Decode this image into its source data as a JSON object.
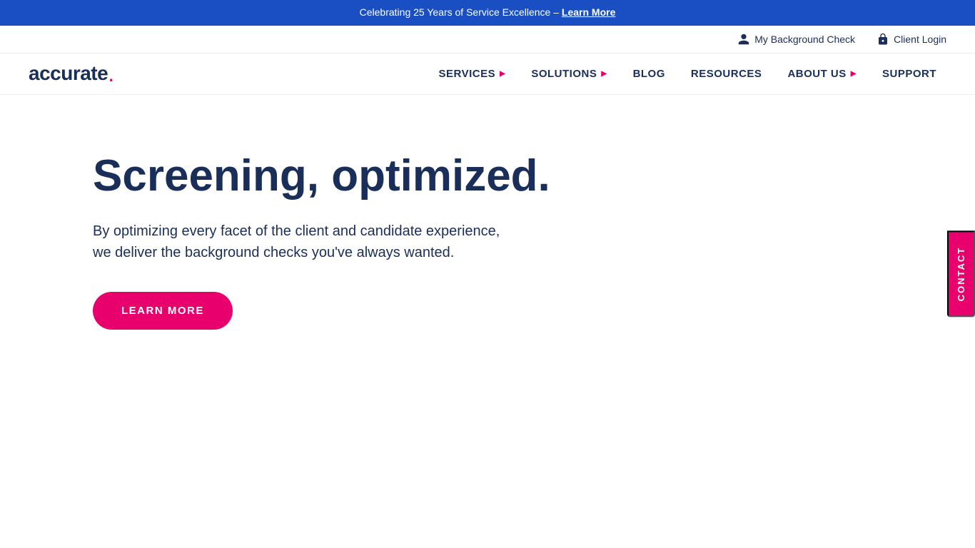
{
  "announcement": {
    "text": "Celebrating 25 Years of Service Excellence – ",
    "link_label": "Learn More"
  },
  "utility_nav": {
    "items": [
      {
        "label": "My Background Check",
        "icon": "person-icon",
        "id": "my-background-check"
      },
      {
        "label": "Client Login",
        "icon": "lock-icon",
        "id": "client-login"
      }
    ]
  },
  "logo": {
    "text": "accurate",
    "dot": "."
  },
  "main_nav": {
    "items": [
      {
        "label": "SERVICES",
        "has_dropdown": true,
        "id": "nav-services"
      },
      {
        "label": "SOLUTIONS",
        "has_dropdown": true,
        "id": "nav-solutions"
      },
      {
        "label": "BLOG",
        "has_dropdown": false,
        "id": "nav-blog"
      },
      {
        "label": "RESOURCES",
        "has_dropdown": false,
        "id": "nav-resources"
      },
      {
        "label": "ABOUT US",
        "has_dropdown": true,
        "id": "nav-about-us"
      },
      {
        "label": "SUPPORT",
        "has_dropdown": false,
        "id": "nav-support"
      }
    ]
  },
  "hero": {
    "title": "Screening, optimized.",
    "subtitle_line1": "By optimizing every facet of the client and candidate experience,",
    "subtitle_line2": "we deliver the background checks you've always wanted.",
    "cta_label": "LEARN MORE"
  },
  "contact_sidebar": {
    "label": "CONTACT"
  },
  "colors": {
    "brand_blue": "#1a2e5a",
    "brand_pink": "#e8006d",
    "banner_blue": "#1a4fc4"
  }
}
